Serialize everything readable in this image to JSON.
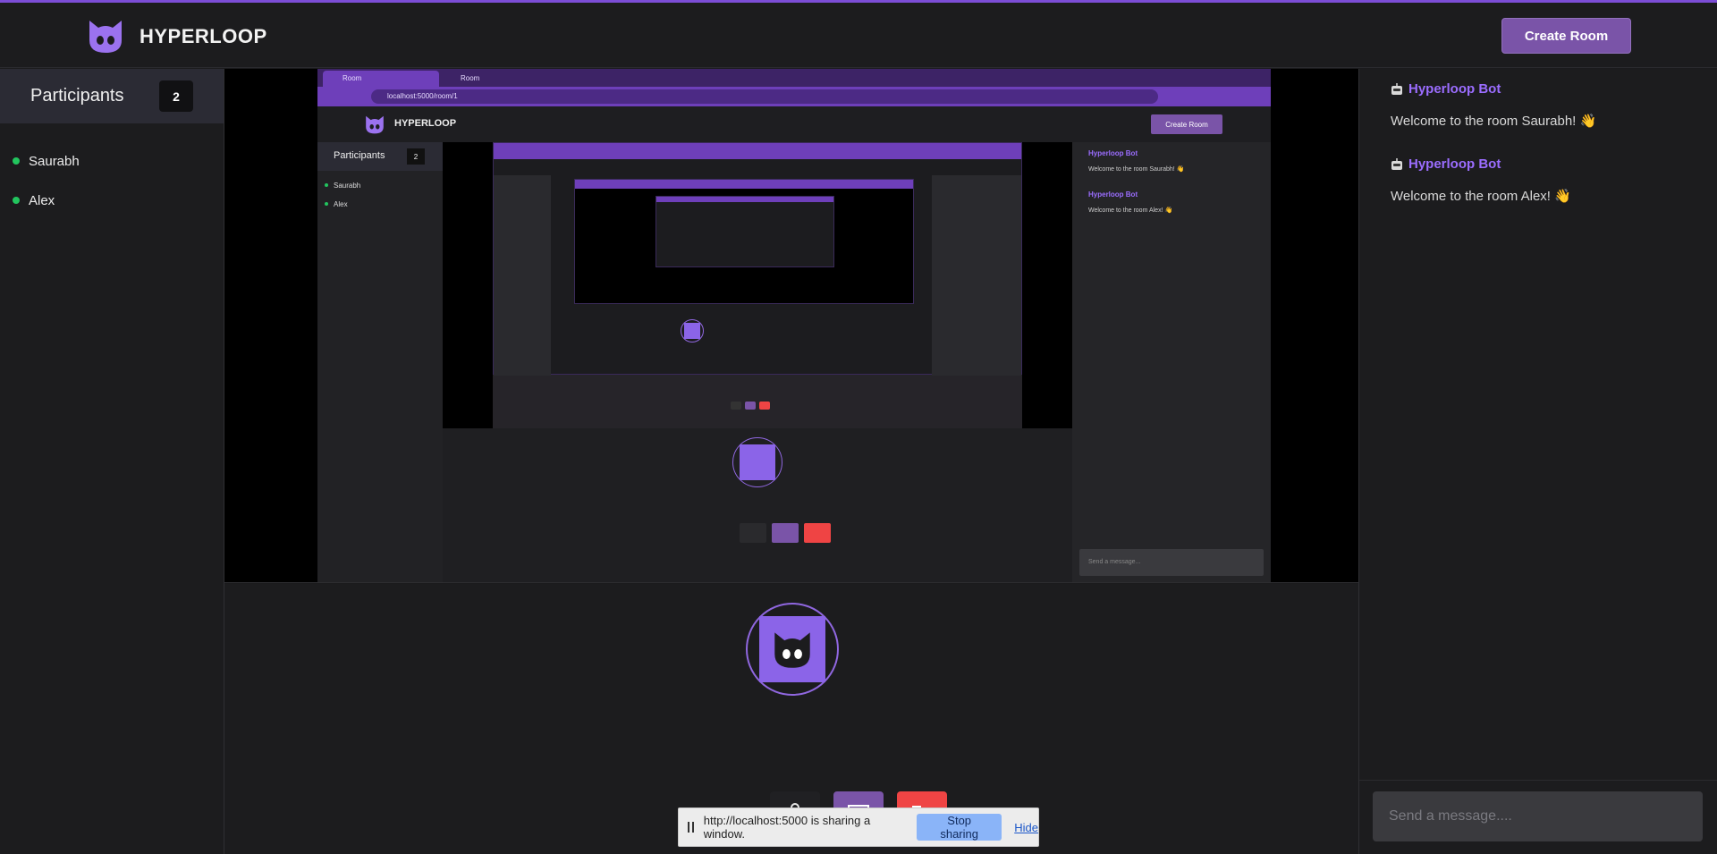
{
  "app": {
    "brand": "HYPERLOOP",
    "create_room_label": "Create Room",
    "accent_color": "#7a54a8",
    "online_color": "#22c55e"
  },
  "sidebar": {
    "title": "Participants",
    "count": "2",
    "participants": [
      {
        "name": "Saurabh"
      },
      {
        "name": "Alex"
      }
    ]
  },
  "shared_window": {
    "tabs": [
      {
        "label": "Room"
      },
      {
        "label": "Room"
      }
    ],
    "url": "localhost:5000/room/1",
    "brand": "HYPERLOOP",
    "create_room_label": "Create Room",
    "participants_title": "Participants",
    "participants_count": "2",
    "participants": [
      "Saurabh",
      "Alex"
    ],
    "chat": [
      {
        "author": "Hyperloop Bot",
        "text": "Welcome to the room Saurabh! 👋"
      },
      {
        "author": "Hyperloop Bot",
        "text": "Welcome to the room Alex! 👋"
      }
    ],
    "chat_placeholder": "Send a message..."
  },
  "share_bar": {
    "text": "http://localhost:5000 is sharing a window.",
    "stop_label": "Stop sharing",
    "hide_label": "Hide"
  },
  "chat": {
    "messages": [
      {
        "author": "Hyperloop Bot",
        "text": "Welcome to the room Saurabh! 👋"
      },
      {
        "author": "Hyperloop Bot",
        "text": "Welcome to the room Alex! 👋"
      }
    ],
    "placeholder": "Send a message...."
  },
  "icons": {
    "logo": "cat-face-icon",
    "mic": "microphone-icon",
    "screen": "screen-share-icon",
    "leave": "leave-icon",
    "bot": "robot-icon"
  }
}
